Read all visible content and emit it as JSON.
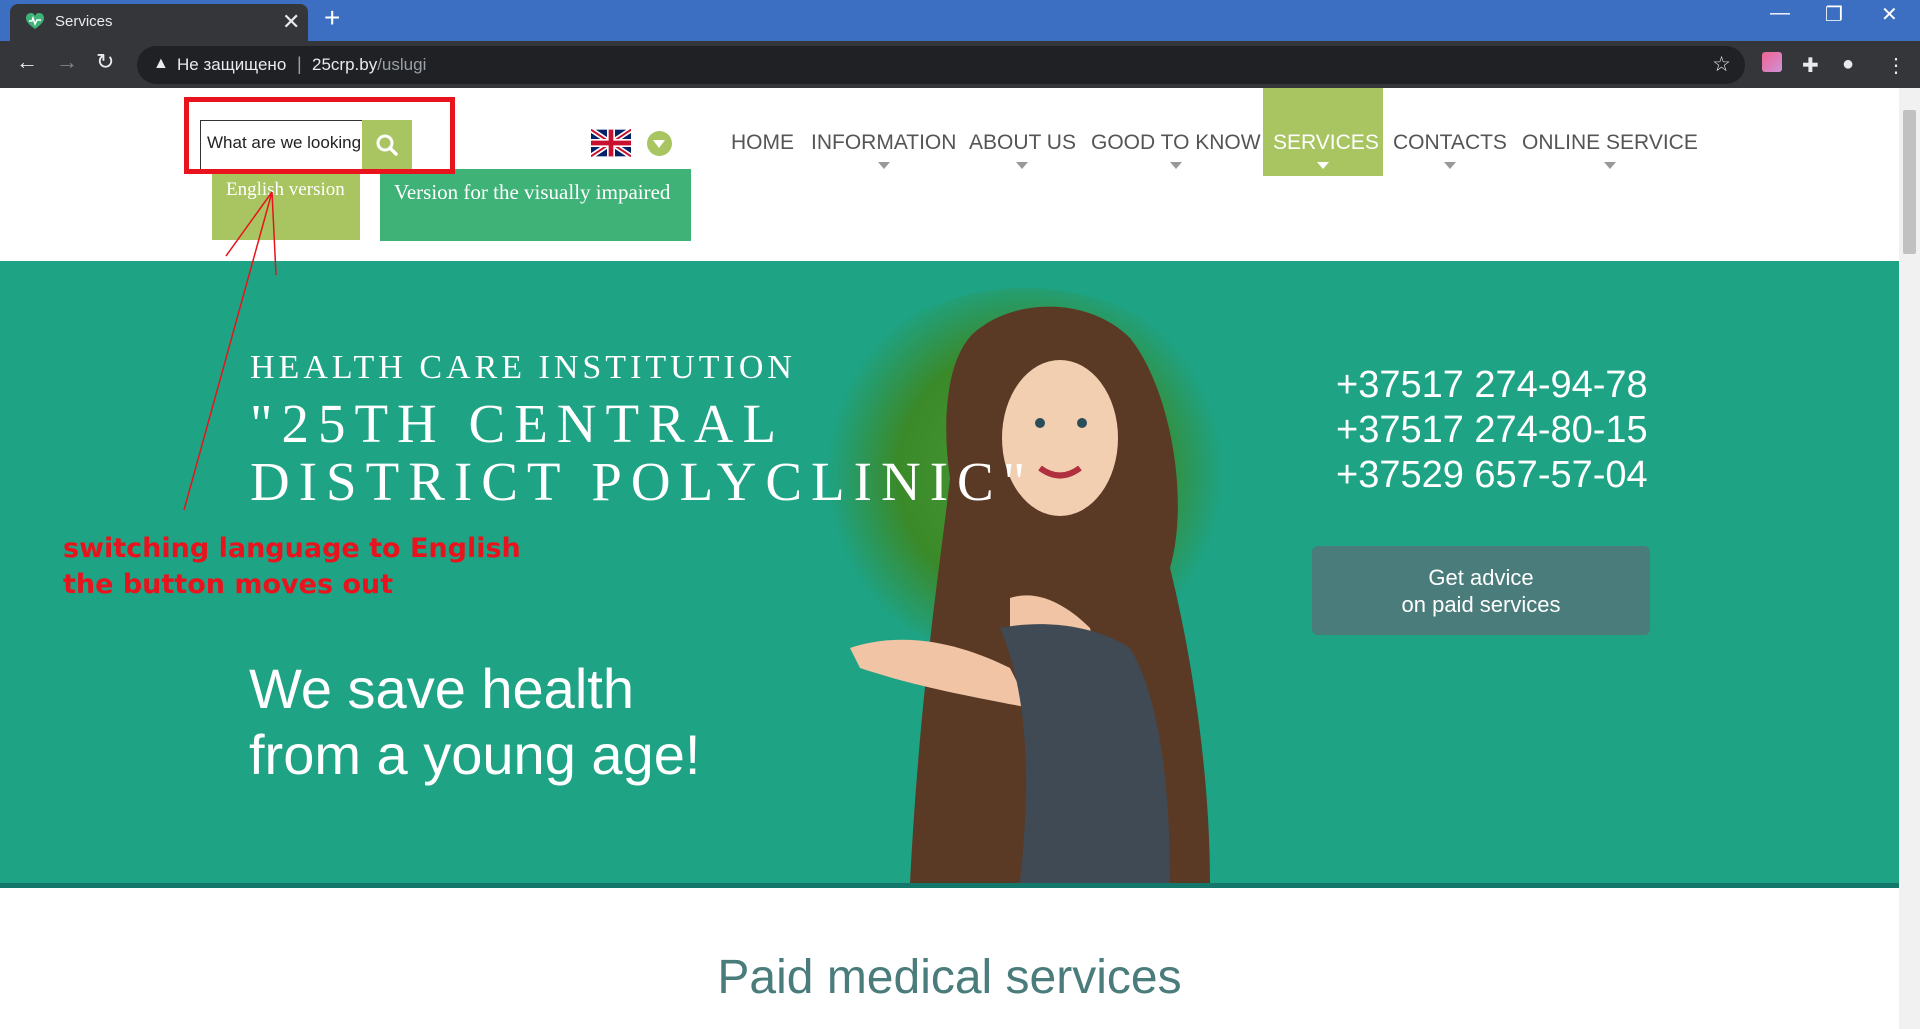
{
  "browser": {
    "tab_title": "Services",
    "new_tab": "+",
    "tab_close": "✕",
    "security_label": "Не защищено",
    "url_domain": "25crp.by",
    "url_path": "/uslugi",
    "window_controls": {
      "minimize": "—",
      "restore": "❐",
      "close": "✕"
    }
  },
  "header": {
    "search_placeholder": "What are we looking for?",
    "english_version": "English version",
    "visually_impaired": "Version for the visually impaired",
    "flag": "uk-flag-icon"
  },
  "nav": {
    "items": [
      {
        "label": "HOME"
      },
      {
        "label": "INFORMATION"
      },
      {
        "label": "ABOUT US"
      },
      {
        "label": "GOOD TO KNOW"
      },
      {
        "label": "SERVICES"
      },
      {
        "label": "CONTACTS"
      },
      {
        "label": "ONLINE SERVICE"
      }
    ],
    "active": "SERVICES"
  },
  "hero": {
    "institution_line1": "HEALTH CARE INSTITUTION",
    "institution_line2": "\"25TH CENTRAL",
    "institution_line3": "DISTRICT POLYCLINIC\"",
    "slogan_line1": "We save health",
    "slogan_line2": "from a young age!",
    "phones": [
      "+37517 274-94-78",
      "+37517 274-80-15",
      "+37529 657-57-04"
    ],
    "advice_line1": "Get advice",
    "advice_line2": "on paid services"
  },
  "annotation": {
    "line1": "switching language to English",
    "line2": "the button moves out"
  },
  "section": {
    "title": "Paid medical services"
  },
  "colors": {
    "hero_bg": "#1ea385",
    "accent_green": "#a8c562",
    "visually_impaired_bg": "#3fb278",
    "advice_bg": "#4a7c7b",
    "annotation_red": "#e8131c"
  }
}
